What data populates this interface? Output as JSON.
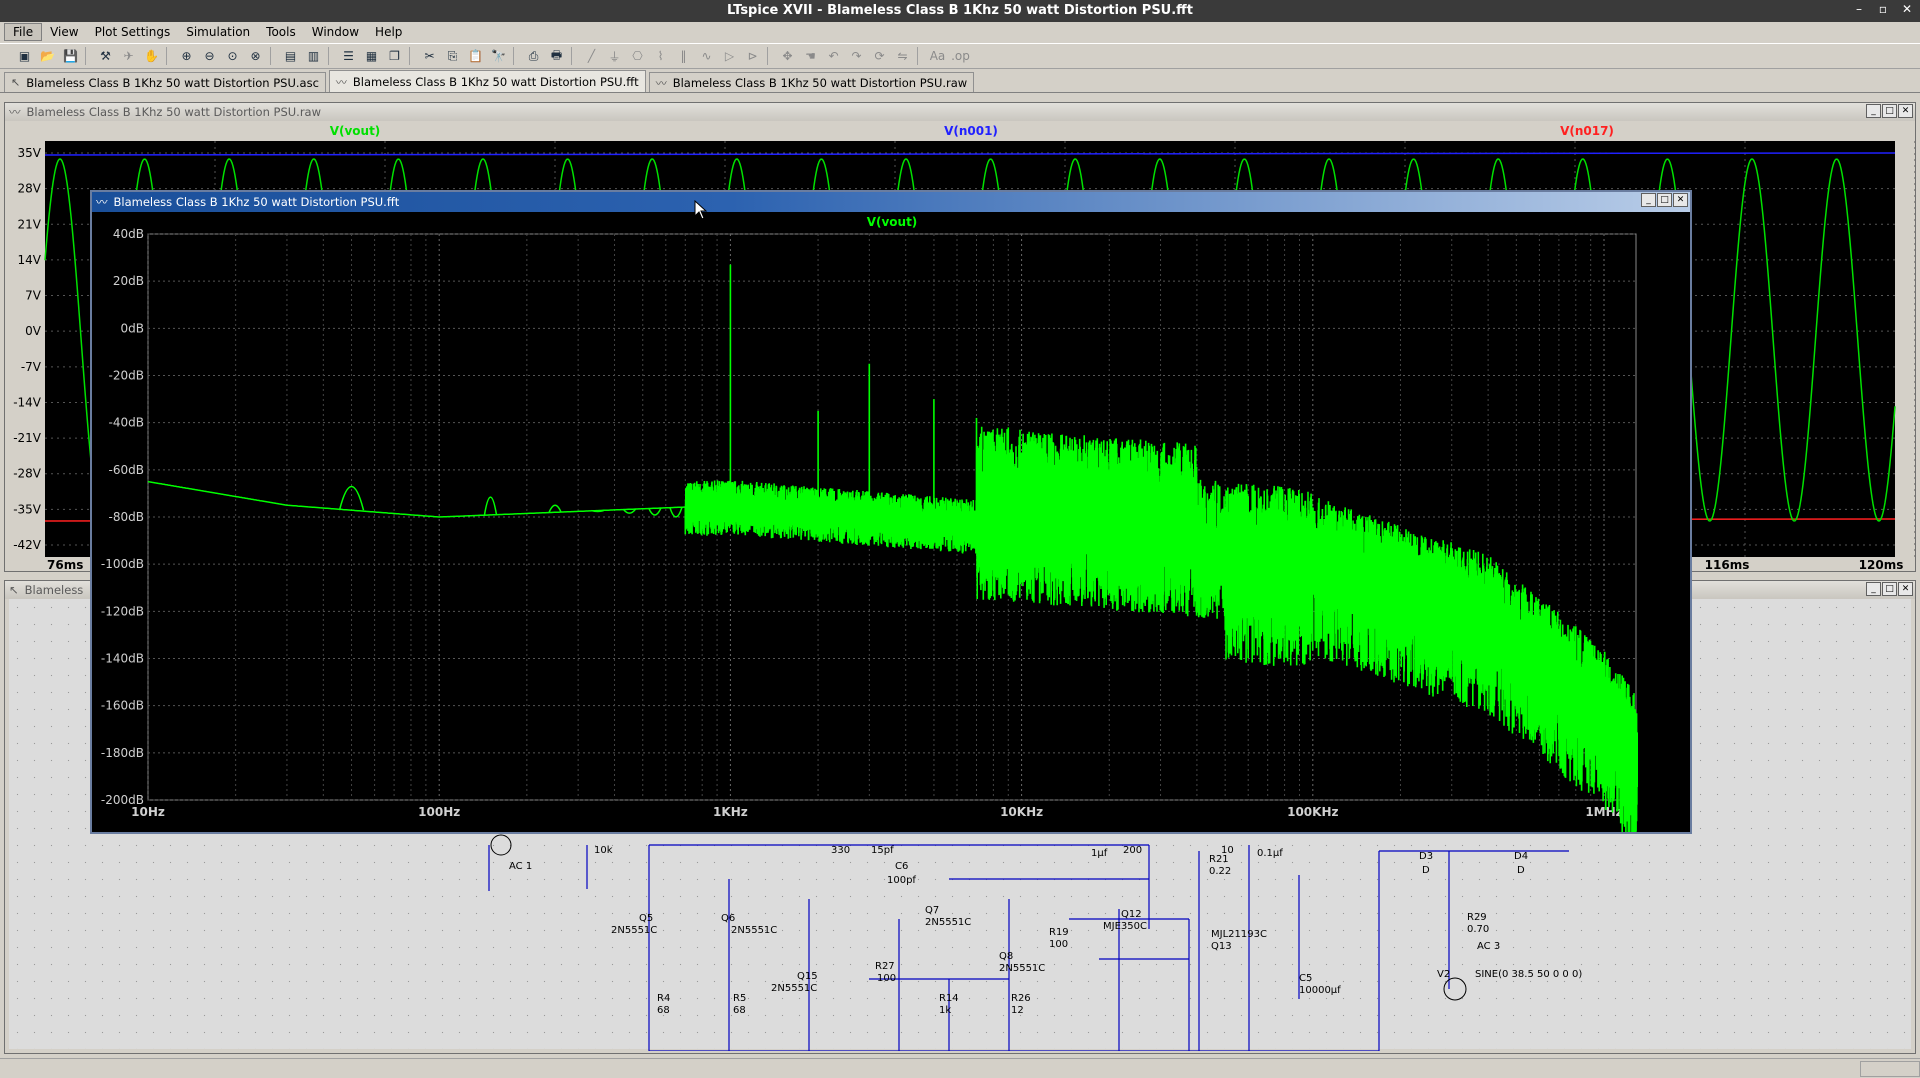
{
  "app": {
    "title": "LTspice XVII - Blameless Class B 1Khz 50 watt Distortion PSU.fft",
    "window_buttons": [
      "–",
      "▫",
      "✕"
    ]
  },
  "menu": [
    "File",
    "View",
    "Plot Settings",
    "Simulation",
    "Tools",
    "Window",
    "Help"
  ],
  "toolbar": {
    "icons": [
      "new-schematic-icon",
      "open-icon",
      "save-icon",
      "control-panel-icon",
      "run-icon",
      "halt-icon",
      "zoom-in-icon",
      "zoom-out-icon",
      "zoom-fit-icon",
      "zoom-cancel-icon",
      "autorange-icon",
      "manual-limits-icon",
      "tile-horizontal-icon",
      "tile-vertical-icon",
      "cascade-icon",
      "cut-icon",
      "copy-icon",
      "paste-icon",
      "find-icon",
      "print-setup-icon",
      "print-icon",
      "wire-icon",
      "ground-icon",
      "label-icon",
      "resistor-icon",
      "capacitor-icon",
      "inductor-icon",
      "diode-icon",
      "component-icon",
      "move-icon",
      "drag-icon",
      "undo-icon",
      "redo-icon",
      "rotate-icon",
      "mirror-icon",
      "text-icon",
      "spice-directive-icon"
    ],
    "glyphs": [
      "▣",
      "📂",
      "💾",
      "⚒",
      "✈",
      "✋",
      "⊕",
      "⊖",
      "⊙",
      "⊗",
      "▤",
      "▥",
      "☰",
      "▦",
      "❐",
      "✂",
      "⎘",
      "📋",
      "🔭",
      "⎙",
      "🖶",
      "╱",
      "⏚",
      "⎔",
      "⌇",
      "‖",
      "∿",
      "▷",
      "⊳",
      "✥",
      "☚",
      "↶",
      "↷",
      "⟳",
      "⇋",
      "Aa",
      ".op"
    ]
  },
  "tabs": [
    {
      "label": "Blameless Class B 1Khz 50 watt Distortion PSU.asc",
      "icon": "schematic-icon"
    },
    {
      "label": "Blameless Class B 1Khz 50 watt Distortion PSU.fft",
      "icon": "waveform-icon"
    },
    {
      "label": "Blameless Class B 1Khz 50 watt Distortion PSU.raw",
      "icon": "waveform-icon"
    }
  ],
  "raw_window": {
    "title": "Blameless Class B 1Khz 50 watt Distortion PSU.raw",
    "traces": [
      {
        "name": "V(vout)",
        "color": "#00e000"
      },
      {
        "name": "V(n001)",
        "color": "#2020ff"
      },
      {
        "name": "V(n017)",
        "color": "#ff2020"
      }
    ],
    "y_ticks": [
      "35V",
      "28V",
      "21V",
      "14V",
      "7V",
      "0V",
      "-7V",
      "-14V",
      "-21V",
      "-28V",
      "-35V",
      "-42V"
    ],
    "x_ticks": [
      "76ms",
      "116ms",
      "120ms"
    ]
  },
  "schem_window": {
    "title": "Blameless Class B 1Khz 50 watt Distortion PSU.asc",
    "title_visible": "Blameless",
    "labels": [
      "AC 1",
      "10k",
      "330",
      "15pf",
      "C6",
      "100pf",
      "1µf",
      "200",
      "R21",
      "0.22",
      "10",
      "0.1µf",
      "D3",
      "D",
      "D4",
      "D",
      "Q5",
      "2N5551C",
      "Q6",
      "2N5551C",
      "Q7",
      "2N5551C",
      "R19",
      "100",
      "Q12",
      "MJE350C",
      "R29",
      "0.70",
      "Q8",
      "2N5551C",
      "MJL21193C",
      "Q13",
      "AC 3",
      "V2",
      "SINE(0 38.5 50 0 0 0)",
      "Q15",
      "2N5551C",
      "R27",
      "100",
      "R4",
      "68",
      "R5",
      "68",
      "R14",
      "1k",
      "R26",
      "12",
      "C5",
      "10000µf"
    ]
  },
  "fft_window": {
    "title": "Blameless Class B 1Khz 50 watt Distortion PSU.fft",
    "trace": "V(vout)",
    "trace_color": "#00ff00",
    "background": "#000000"
  },
  "chart_data": {
    "type": "line",
    "title": "",
    "series": [
      {
        "name": "V(vout)",
        "color": "#00ff00"
      }
    ],
    "xscale": "log",
    "xlim": [
      10,
      1300000
    ],
    "ylim": [
      -200,
      40
    ],
    "x_ticks": [
      10,
      100,
      1000,
      10000,
      100000,
      1000000
    ],
    "x_tick_labels": [
      "10Hz",
      "100Hz",
      "1KHz",
      "10KHz",
      "100KHz",
      "1MHz"
    ],
    "y_ticks": [
      40,
      20,
      0,
      -20,
      -40,
      -60,
      -80,
      -100,
      -120,
      -140,
      -160,
      -180,
      -200
    ],
    "y_tick_labels": [
      "40dB",
      "20dB",
      "0dB",
      "-20dB",
      "-40dB",
      "-60dB",
      "-80dB",
      "-100dB",
      "-120dB",
      "-140dB",
      "-160dB",
      "-180dB",
      "-200dB"
    ],
    "grid": true,
    "peaks": [
      {
        "f": 50,
        "db": -45
      },
      {
        "f": 150,
        "db": -52
      },
      {
        "f": 250,
        "db": -60
      },
      {
        "f": 1000,
        "db": 27
      },
      {
        "f": 2000,
        "db": -35
      },
      {
        "f": 3000,
        "db": -15
      },
      {
        "f": 5000,
        "db": -30
      },
      {
        "f": 7000,
        "db": -38
      },
      {
        "f": 9000,
        "db": -42
      }
    ],
    "floor": [
      {
        "f": 10,
        "db": -65
      },
      {
        "f": 30,
        "db": -75
      },
      {
        "f": 100,
        "db": -80
      },
      {
        "f": 1000,
        "db": -75
      },
      {
        "f": 10000,
        "db": -85
      },
      {
        "f": 100000,
        "db": -95
      },
      {
        "f": 400000,
        "db": -120
      },
      {
        "f": 1000000,
        "db": -160
      },
      {
        "f": 1300000,
        "db": -180
      }
    ]
  },
  "status": {
    "text": ""
  }
}
